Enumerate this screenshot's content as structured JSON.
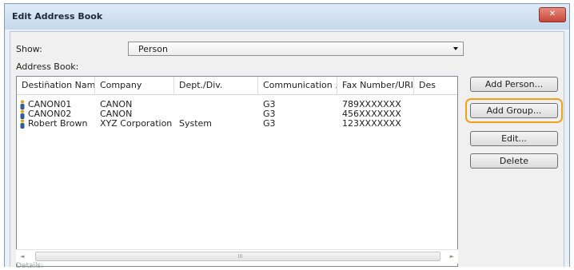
{
  "window": {
    "title": "Edit Address Book",
    "close_glyph": "✕"
  },
  "show": {
    "label": "Show:",
    "value": "Person"
  },
  "address_book": {
    "label": "Address Book:",
    "columns": [
      "Destination Name",
      "Company",
      "Dept./Div.",
      "Communication ...",
      "Fax Number/URI",
      "Des"
    ],
    "rows": [
      {
        "name": "CANON01",
        "company": "CANON",
        "dept": "",
        "communication": "G3",
        "fax": "789XXXXXXX"
      },
      {
        "name": "CANON02",
        "company": "CANON",
        "dept": "",
        "communication": "G3",
        "fax": "456XXXXXXX"
      },
      {
        "name": "Robert Brown",
        "company": "XYZ Corporation",
        "dept": "System",
        "communication": "G3",
        "fax": "123XXXXXXX"
      }
    ],
    "scroll_left": "◄",
    "scroll_right": "►",
    "scroll_grip": "III"
  },
  "buttons": {
    "add_person": "Add Person...",
    "add_group": "Add Group...",
    "edit": "Edit...",
    "delete": "Delete"
  },
  "details_label": "Details:",
  "colors": {
    "accent_highlight": "#f3a017",
    "person_icon_head": "#e0a321",
    "person_icon_body": "#2f5d9c"
  }
}
